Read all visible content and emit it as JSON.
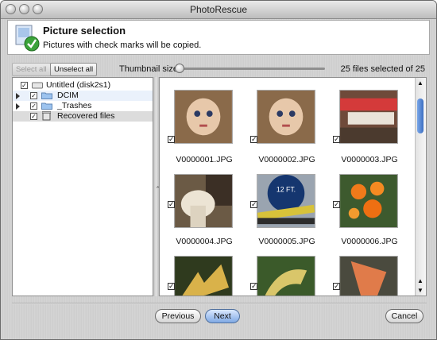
{
  "window": {
    "title": "PhotoRescue"
  },
  "header": {
    "title": "Picture selection",
    "subtitle": "Pictures with check marks will be copied."
  },
  "toolbar": {
    "select_all": "Select all",
    "unselect_all": "Unselect all",
    "thumbnail_label": "Thumbnail size",
    "count_text": "25 files selected of 25"
  },
  "tree": [
    {
      "label": "Untitled (disk2s1)",
      "checked": true,
      "icon": "disk-icon"
    },
    {
      "label": "DCIM",
      "checked": true,
      "icon": "folder-icon"
    },
    {
      "label": "_Trashes",
      "checked": true,
      "icon": "folder-icon"
    },
    {
      "label": "Recovered files",
      "checked": true,
      "icon": "trash-icon"
    }
  ],
  "thumbnails": [
    {
      "name": "V0000001.JPG",
      "checked": true
    },
    {
      "name": "V0000002.JPG",
      "checked": true
    },
    {
      "name": "V0000003.JPG",
      "checked": true
    },
    {
      "name": "V0000004.JPG",
      "checked": true
    },
    {
      "name": "V0000005.JPG",
      "checked": true
    },
    {
      "name": "V0000006.JPG",
      "checked": true
    },
    {
      "name": "",
      "checked": true
    },
    {
      "name": "",
      "checked": true
    },
    {
      "name": "",
      "checked": true
    }
  ],
  "thumbnail_preview_text": {
    "item5_caption": "12 FT."
  },
  "buttons": {
    "previous": "Previous",
    "next": "Next",
    "cancel": "Cancel"
  }
}
